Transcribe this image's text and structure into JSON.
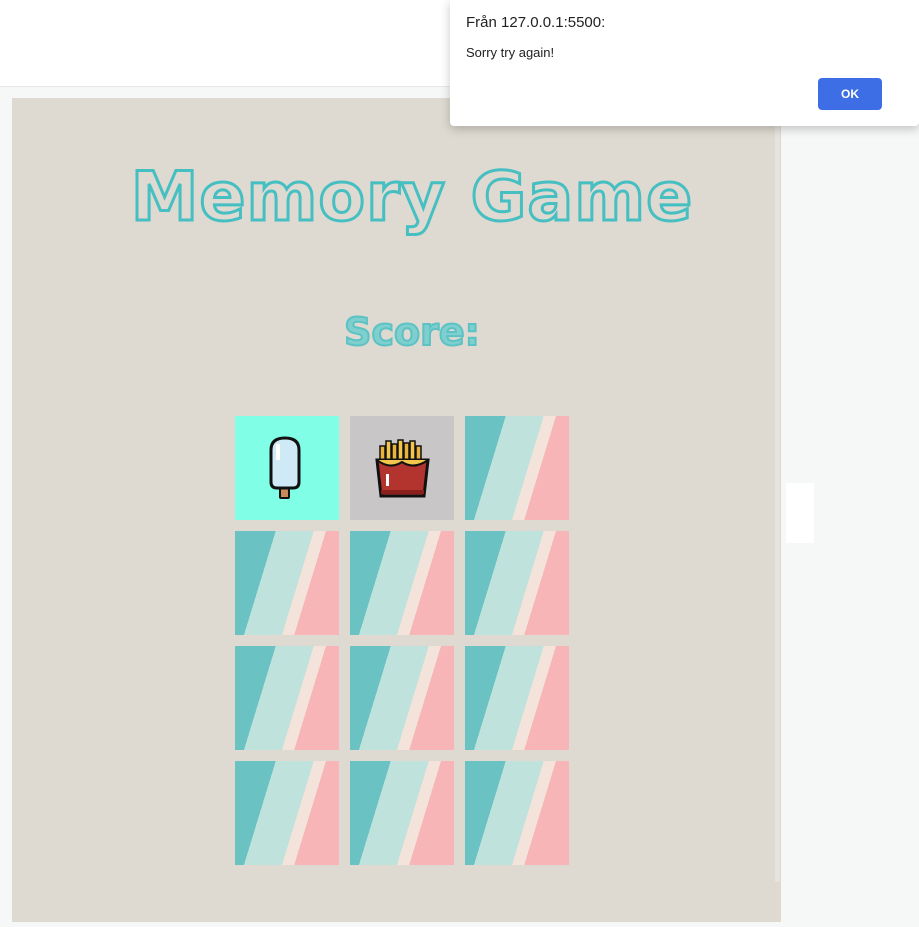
{
  "alert": {
    "title": "Från 127.0.0.1:5500:",
    "message": "Sorry try again!",
    "ok_label": "OK"
  },
  "game": {
    "title": "Memory Game",
    "score_label": "Score:",
    "cards": [
      {
        "state": "face-up",
        "icon": "popsicle-icon",
        "background": "#80ffe6"
      },
      {
        "state": "face-up",
        "icon": "french-fries-icon",
        "background": "#c9c6c8"
      },
      {
        "state": "face-down"
      },
      {
        "state": "face-down"
      },
      {
        "state": "face-down"
      },
      {
        "state": "face-down"
      },
      {
        "state": "face-down"
      },
      {
        "state": "face-down"
      },
      {
        "state": "face-down"
      },
      {
        "state": "face-down"
      },
      {
        "state": "face-down"
      },
      {
        "state": "face-down"
      }
    ]
  },
  "colors": {
    "stage_bg": "#dedad1",
    "title_stroke": "#45bfc2",
    "card_stripe_teal": "#6bc2c2",
    "card_stripe_mint": "#bfe3dc",
    "card_stripe_cream": "#f3e3da",
    "card_stripe_pink": "#f8b5b8",
    "ok_button": "#3d6ee6"
  }
}
